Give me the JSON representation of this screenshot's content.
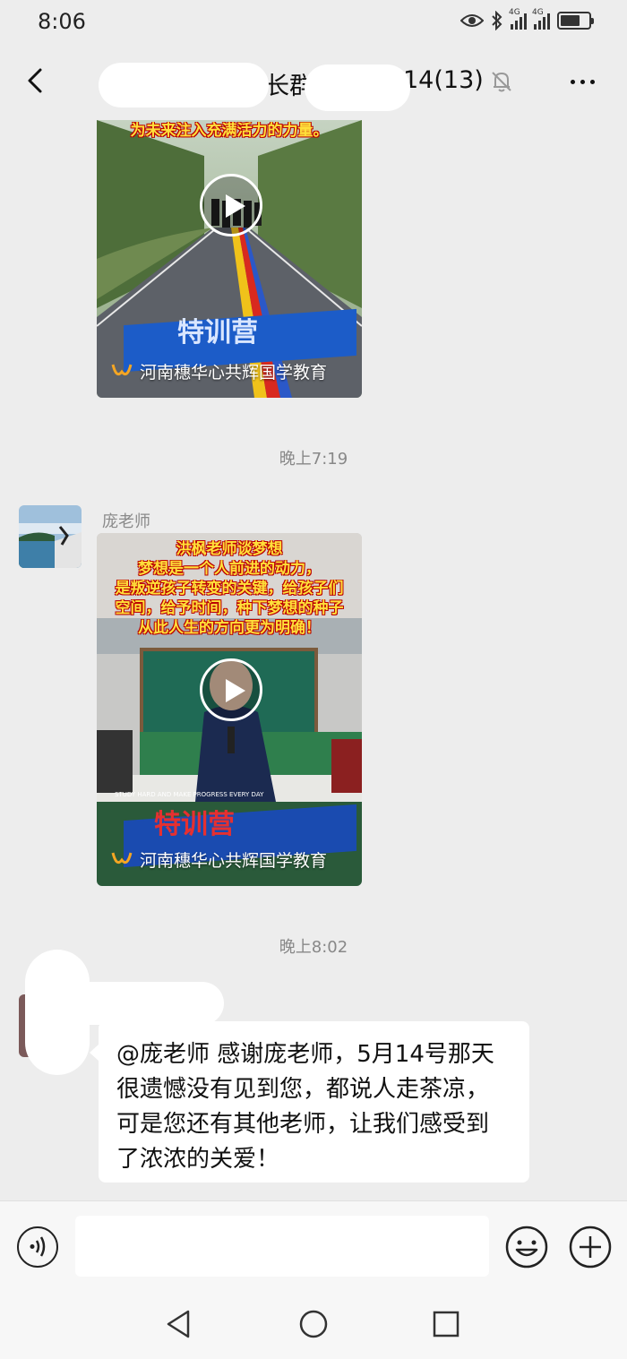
{
  "status_bar": {
    "time": "8:06",
    "signal_1_label": "4G",
    "signal_2_label": "4G"
  },
  "header": {
    "title_part1": "长群2",
    "title_part2": "14(13)"
  },
  "messages": {
    "video1": {
      "caption": "为未来注入充满活力的力量。",
      "banner": "特训营",
      "brand": "河南穗华心共辉国学教育"
    },
    "time1": "晚上7:19",
    "sender2": "庞老师",
    "video2": {
      "caption_lines": [
        "洪枫老师谈梦想",
        "梦想是一个人前进的动力，",
        "是叛逆孩子转变的关键，给孩子们",
        "空间，给予时间，种下梦想的种子",
        "从此人生的方向更为明确！"
      ],
      "board_text": "STUDY HARD AND MAKE PROGRESS EVERY DAY",
      "banner": "特训营",
      "brand": "河南穗华心共辉国学教育"
    },
    "time2": "晚上8:02",
    "bubble_text": "@庞老师  感谢庞老师，5月14号那天很遗憾没有见到您，都说人走茶凉，可是您还有其他老师，让我们感受到了浓浓的关爱！"
  },
  "input_bar": {
    "placeholder": ""
  },
  "colors": {
    "background": "#ededed",
    "bubble": "#ffffff",
    "caption_yellow": "#ffe03a",
    "caption_outline": "#bb0000",
    "banner_blue": "#1c5cc8"
  }
}
